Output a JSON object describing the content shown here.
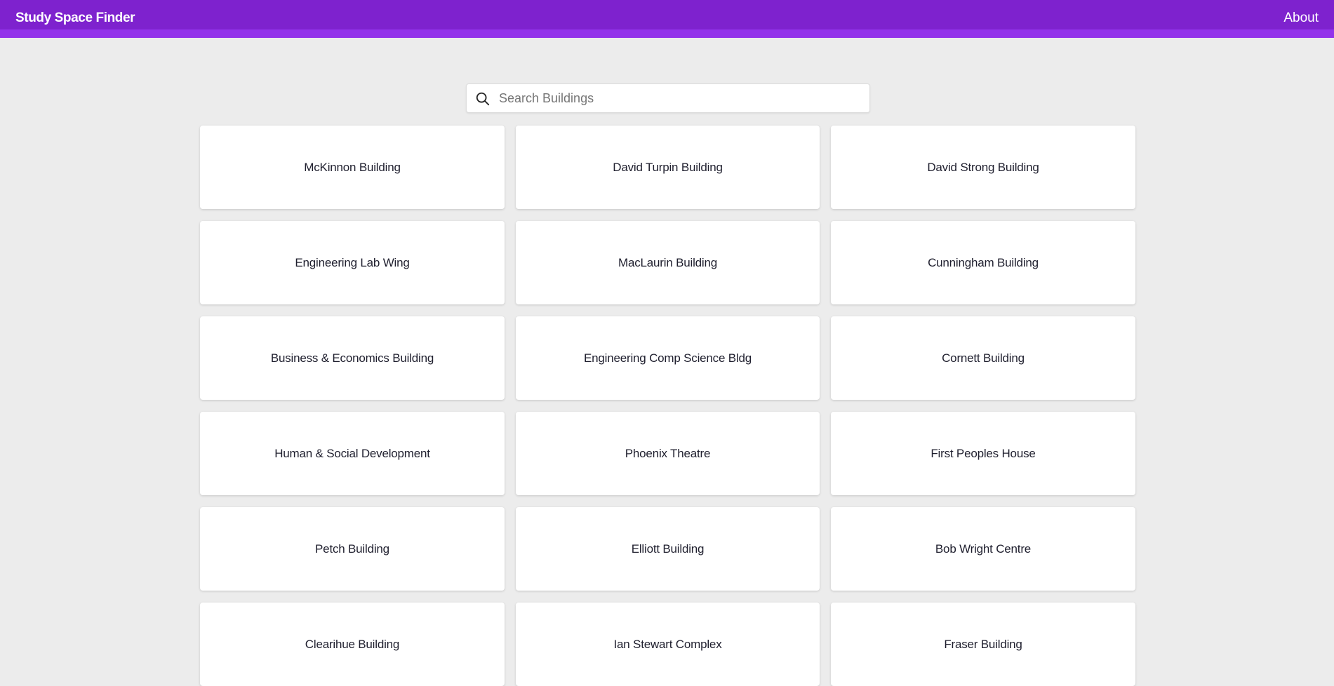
{
  "header": {
    "title": "Study Space Finder",
    "about_label": "About",
    "accent_color": "#7e22ce",
    "accent_stripe_color": "#9333ea"
  },
  "search": {
    "placeholder": "Search Buildings",
    "value": "",
    "icon": "search-icon"
  },
  "buildings": [
    "McKinnon Building",
    "David Turpin Building",
    "David Strong Building",
    "Engineering Lab Wing",
    "MacLaurin Building",
    "Cunningham Building",
    "Business & Economics Building",
    "Engineering Comp Science Bldg",
    "Cornett Building",
    "Human & Social Development",
    "Phoenix Theatre",
    "First Peoples House",
    "Petch Building",
    "Elliott Building",
    "Bob Wright Centre",
    "Clearihue Building",
    "Ian Stewart Complex",
    "Fraser Building"
  ]
}
